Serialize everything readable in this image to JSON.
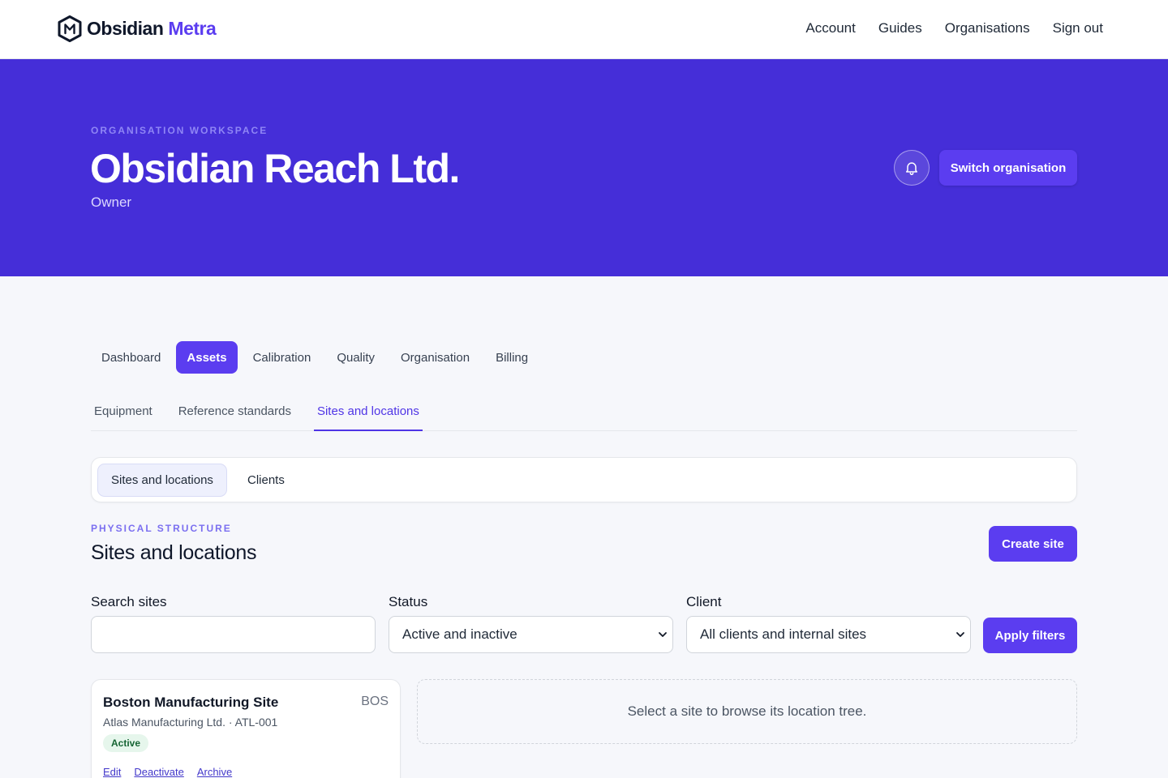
{
  "brand": {
    "name": "Obsidian",
    "accent": "Metra",
    "logo_letter": "M"
  },
  "topnav": [
    "Account",
    "Guides",
    "Organisations",
    "Sign out"
  ],
  "hero": {
    "eyebrow": "ORGANISATION WORKSPACE",
    "title": "Obsidian Reach Ltd.",
    "role": "Owner",
    "bell_icon": "bell-icon",
    "switch_label": "Switch organisation"
  },
  "tabs": [
    {
      "label": "Dashboard",
      "active": false
    },
    {
      "label": "Assets",
      "active": true
    },
    {
      "label": "Calibration",
      "active": false
    },
    {
      "label": "Quality",
      "active": false
    },
    {
      "label": "Organisation",
      "active": false
    },
    {
      "label": "Billing",
      "active": false
    }
  ],
  "subtabs": [
    {
      "label": "Equipment",
      "active": false
    },
    {
      "label": "Reference standards",
      "active": false
    },
    {
      "label": "Sites and locations",
      "active": true
    }
  ],
  "segments": [
    {
      "label": "Sites and locations",
      "active": true
    },
    {
      "label": "Clients",
      "active": false
    }
  ],
  "section": {
    "eyebrow": "PHYSICAL STRUCTURE",
    "title": "Sites and locations",
    "create_label": "Create site"
  },
  "filters": {
    "search_label": "Search sites",
    "search_value": "",
    "status_label": "Status",
    "status_value": "Active and inactive",
    "client_label": "Client",
    "client_value": "All clients and internal sites",
    "apply_label": "Apply filters"
  },
  "sites": [
    {
      "name": "Boston Manufacturing Site",
      "code": "BOS",
      "subtitle": "Atlas Manufacturing Ltd. · ATL-001",
      "status": "Active",
      "actions": [
        "Edit",
        "Deactivate",
        "Archive"
      ]
    }
  ],
  "empty_message": "Select a site to browse its location tree.",
  "colors": {
    "primary": "#5b3df0",
    "hero_bg": "#452ed8",
    "badge_active_bg": "#e6f6ec",
    "badge_active_text": "#166534"
  }
}
